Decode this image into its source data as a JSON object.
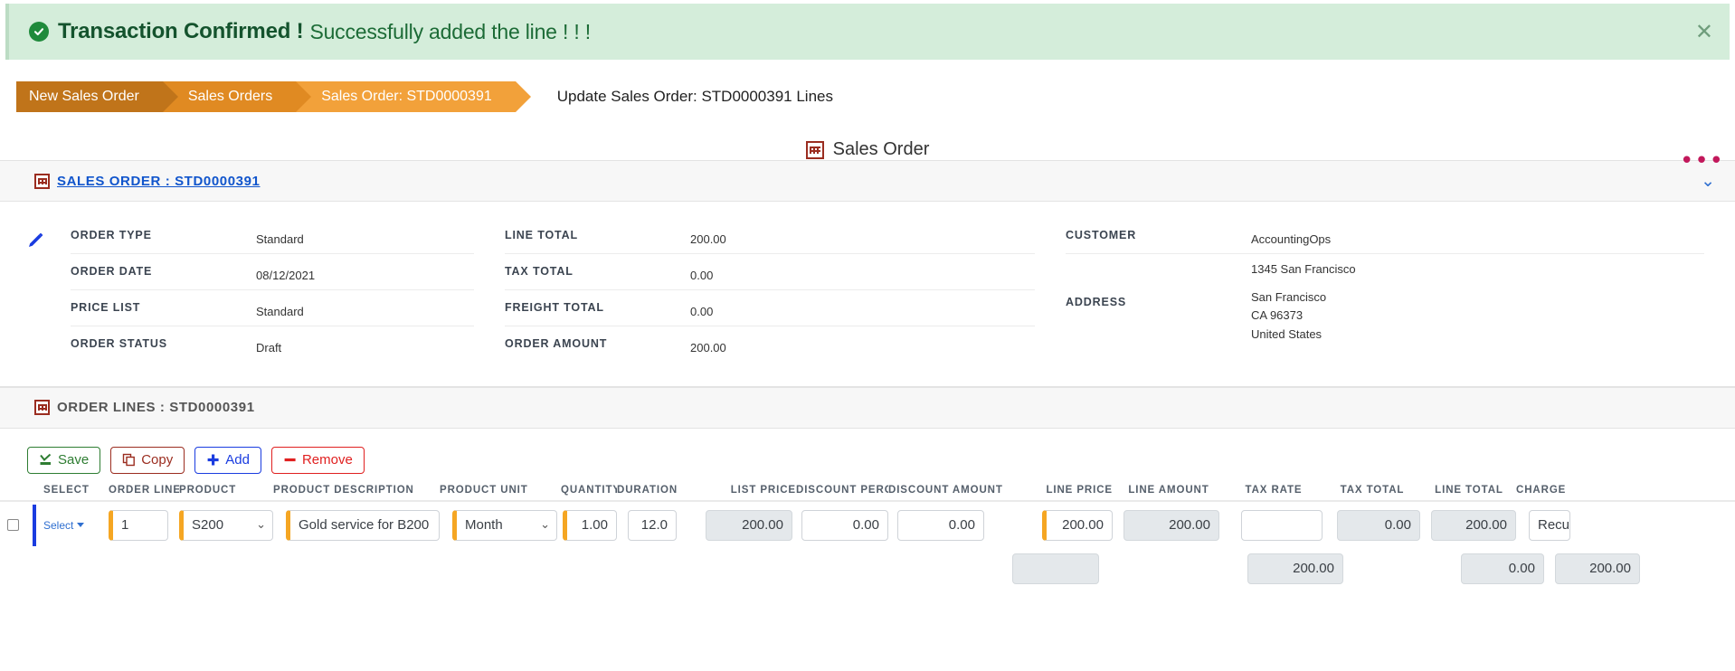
{
  "alert": {
    "icon": "check-circle-icon",
    "strong": "Transaction Confirmed !",
    "message": "Successfully added the line ! ! !",
    "close_label": "✕"
  },
  "breadcrumb": {
    "items": [
      {
        "label": "New Sales Order"
      },
      {
        "label": "Sales Orders"
      },
      {
        "label": "Sales Order: STD0000391"
      }
    ],
    "caption": "Update Sales Order: STD0000391 Lines"
  },
  "overflow_menu": {
    "label": "•••"
  },
  "entity": {
    "title": "Sales Order",
    "icon": "grid-icon"
  },
  "order_panel": {
    "title": "SALES ORDER : STD0000391",
    "collapse_label": "⌄",
    "edit_icon": "pencil-icon",
    "columns": [
      {
        "fields": [
          {
            "label": "ORDER TYPE",
            "value": "Standard"
          },
          {
            "label": "ORDER DATE",
            "value": "08/12/2021"
          },
          {
            "label": "PRICE LIST",
            "value": "Standard"
          },
          {
            "label": "ORDER STATUS",
            "value": "Draft"
          }
        ]
      },
      {
        "fields": [
          {
            "label": "LINE TOTAL",
            "value": "200.00"
          },
          {
            "label": "TAX TOTAL",
            "value": "0.00"
          },
          {
            "label": "FREIGHT TOTAL",
            "value": "0.00"
          },
          {
            "label": "ORDER AMOUNT",
            "value": "200.00"
          }
        ]
      }
    ],
    "customer": {
      "label": "CUSTOMER",
      "value": "AccountingOps"
    },
    "address": {
      "label": "ADDRESS",
      "line1": "1345 San Francisco",
      "city": "San Francisco",
      "region": "CA 96373",
      "country": "United States"
    }
  },
  "lines_panel": {
    "title": "ORDER LINES : STD0000391",
    "toolbar": [
      {
        "name": "save",
        "label": "Save",
        "icon": "save-icon",
        "color": "#2e7d32"
      },
      {
        "name": "copy",
        "label": "Copy",
        "icon": "copy-icon",
        "color": "#9b2d20"
      },
      {
        "name": "add",
        "label": "Add",
        "icon": "plus-icon",
        "color": "#1a3ce0"
      },
      {
        "name": "remove",
        "label": "Remove",
        "icon": "minus-icon",
        "color": "#e02020"
      }
    ],
    "columns": [
      "SELECT",
      "ORDER LINE",
      "PRODUCT",
      "PRODUCT DESCRIPTION",
      "PRODUCT UNIT",
      "QUANTITY",
      "DURATION",
      "LIST PRICE",
      "DISCOUNT PERCENT",
      "DISCOUNT AMOUNT",
      "LINE PRICE",
      "LINE AMOUNT",
      "TAX RATE",
      "TAX TOTAL",
      "LINE TOTAL",
      "CHARGE"
    ],
    "row": {
      "select_label": "Select",
      "order_line": "1",
      "product": "S200",
      "product_description": "Gold service for B200",
      "product_unit": "Month",
      "quantity": "1.00",
      "duration": "12.0",
      "list_price": "200.00",
      "discount_percent": "0.00",
      "discount_amount": "0.00",
      "line_price": "200.00",
      "line_amount": "200.00",
      "tax_rate": "",
      "tax_total": "0.00",
      "line_total": "200.00",
      "charge": "Recurring"
    },
    "totals": {
      "discount_amount": "",
      "line_amount": "200.00",
      "tax_total": "0.00",
      "line_total": "200.00"
    }
  }
}
